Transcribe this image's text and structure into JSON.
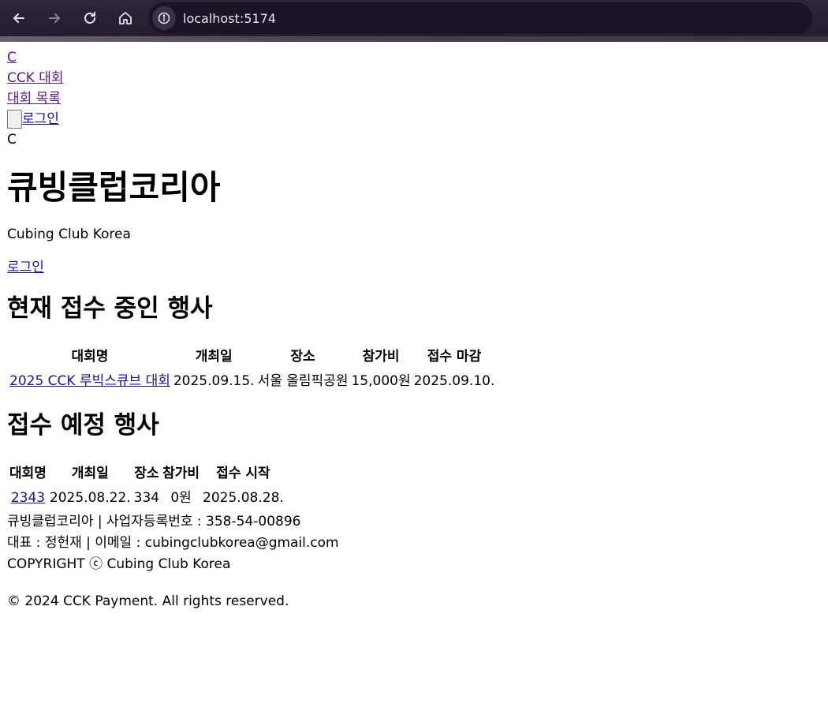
{
  "browser": {
    "url": "localhost:5174",
    "back_icon": "arrow-left-icon",
    "forward_icon": "arrow-right-icon",
    "reload_icon": "reload-icon",
    "home_icon": "home-icon",
    "site_info_icon": "info-icon"
  },
  "header": {
    "logo_link": "C",
    "brand_link": "CCK 대회",
    "competitions_link": "대회 목록",
    "login_link": "로그인",
    "logo_text": "C"
  },
  "hero": {
    "title": "큐빙클럽코리아",
    "subtitle": "Cubing Club Korea",
    "login_link": "로그인"
  },
  "open_events": {
    "heading": "현재 접수 중인 행사",
    "columns": [
      "대회명",
      "개최일",
      "장소",
      "참가비",
      "접수 마감"
    ],
    "rows": [
      {
        "name": "2025 CCK 루빅스큐브 대회",
        "date": "2025.09.15.",
        "venue": "서울 올림픽공원",
        "fee": "15,000원",
        "deadline": "2025.09.10."
      }
    ]
  },
  "upcoming_events": {
    "heading": "접수 예정 행사",
    "columns": [
      "대회명",
      "개최일",
      "장소",
      "참가비",
      "접수 시작"
    ],
    "rows": [
      {
        "name": "2343",
        "date": "2025.08.22.",
        "venue": "334",
        "fee": "0원",
        "start": "2025.08.28."
      }
    ]
  },
  "footer": {
    "line1": "큐빙클럽코리아 | 사업자등록번호 : 358-54-00896",
    "line2": "대표 : 정헌재 | 이메일 : cubingclubkorea@gmail.com",
    "line3": "COPYRIGHT ⓒ Cubing Club Korea",
    "payment_copyright": "© 2024 CCK Payment. All rights reserved."
  }
}
